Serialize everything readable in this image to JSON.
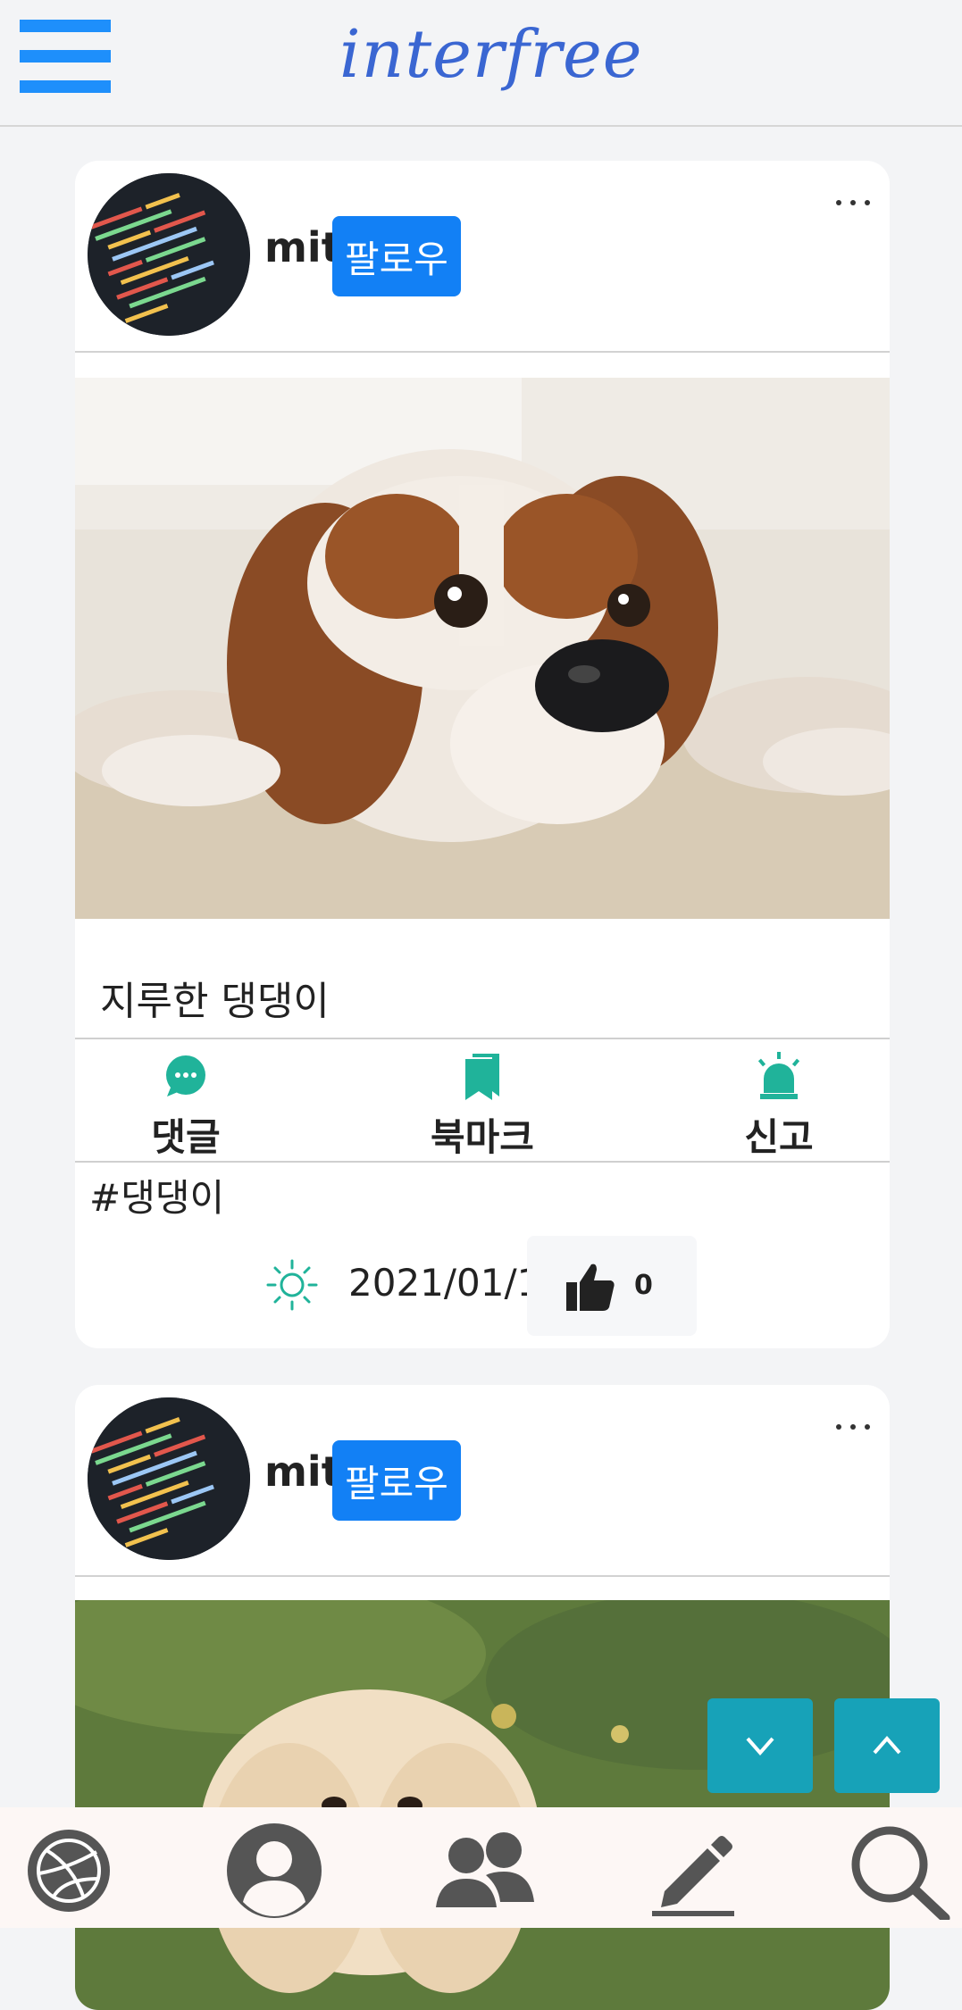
{
  "app": {
    "logo": "interfree",
    "accent": "#1e8ffb",
    "logo_color": "#3a66d2"
  },
  "posts": [
    {
      "username": "mit",
      "follow_label": "팔로우",
      "caption": "지루한 댕댕이",
      "actions": [
        {
          "label": "댓글",
          "icon": "comment-icon"
        },
        {
          "label": "북마크",
          "icon": "bookmark-icon"
        },
        {
          "label": "신고",
          "icon": "siren-icon"
        }
      ],
      "hashtag": "#댕댕이",
      "date": "2021/01/12",
      "likes": "0"
    },
    {
      "username": "mit",
      "follow_label": "팔로우"
    }
  ],
  "colors": {
    "action_icon": "#20b39a",
    "follow_button": "#1280f5",
    "scroll_button": "#17a2b8"
  },
  "bottom_nav": [
    {
      "icon": "dribbble-icon"
    },
    {
      "icon": "user-icon"
    },
    {
      "icon": "users-icon"
    },
    {
      "icon": "pen-icon"
    },
    {
      "icon": "search-icon"
    }
  ]
}
